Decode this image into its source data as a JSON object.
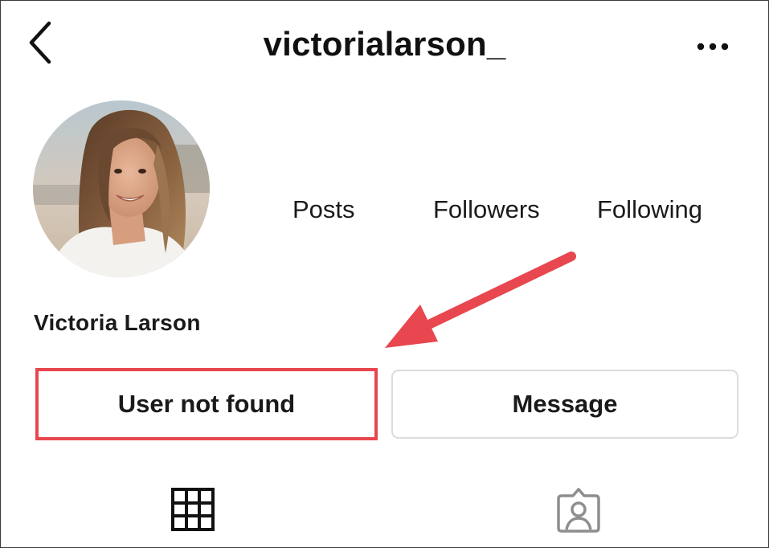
{
  "header": {
    "username": "victorialarson_",
    "back_icon": "chevron-left-icon",
    "more_icon": "more-horizontal-icon"
  },
  "profile": {
    "avatar_icon": "profile-photo",
    "display_name": "Victoria Larson",
    "stats": {
      "posts_label": "Posts",
      "followers_label": "Followers",
      "following_label": "Following"
    }
  },
  "actions": {
    "primary_label": "User not found",
    "message_label": "Message"
  },
  "annotation": {
    "highlight_color": "#e8474f",
    "arrow_color": "#e8474f"
  },
  "tabs": [
    {
      "icon": "grid-icon",
      "active": true
    },
    {
      "icon": "tagged-person-icon",
      "active": false
    }
  ]
}
